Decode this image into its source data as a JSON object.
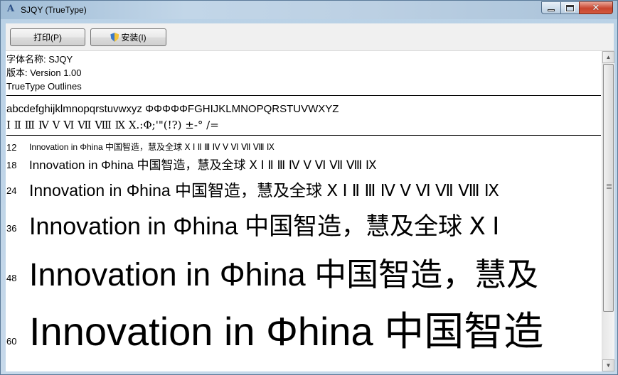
{
  "window": {
    "title": "SJQY (TrueType)"
  },
  "toolbar": {
    "print_label": "打印(P)",
    "install_label": "安装(I)"
  },
  "font_info": {
    "name_line": "字体名称: SJQY",
    "version_line": "版本: Version 1.00",
    "outline_line": "TrueType Outlines"
  },
  "charset": {
    "line1": "abcdefghijklmnopqrstuvwxyz ΦΦΦΦΦFGHIJKLMNOPQRSTUVWXYZ",
    "line2": "Ⅰ Ⅱ Ⅲ Ⅳ Ⅴ Ⅵ Ⅶ Ⅷ Ⅸ Ⅹ.:Φ;'\"(!?) ±-° /="
  },
  "samples": [
    {
      "size": "12",
      "text": "Innovation in Φhina 中国智造，慧及全球 Ⅹ Ⅰ Ⅱ Ⅲ Ⅳ Ⅴ Ⅵ Ⅶ Ⅷ Ⅸ"
    },
    {
      "size": "18",
      "text": "Innovation in Φhina 中国智造，慧及全球 Ⅹ Ⅰ Ⅱ Ⅲ Ⅳ Ⅴ Ⅵ Ⅶ Ⅷ Ⅸ"
    },
    {
      "size": "24",
      "text": "Innovation in Φhina 中国智造，慧及全球 Ⅹ Ⅰ Ⅱ Ⅲ Ⅳ Ⅴ Ⅵ Ⅶ Ⅷ Ⅸ"
    },
    {
      "size": "36",
      "text": "Innovation in Φhina 中国智造，慧及全球 Ⅹ Ⅰ"
    },
    {
      "size": "48",
      "text": "Innovation in Φhina 中国智造，慧及"
    },
    {
      "size": "60",
      "text": "Innovation in Φhina 中国智造"
    }
  ],
  "icons": {
    "app": "font-viewer-icon",
    "install": "uac-shield-icon"
  }
}
